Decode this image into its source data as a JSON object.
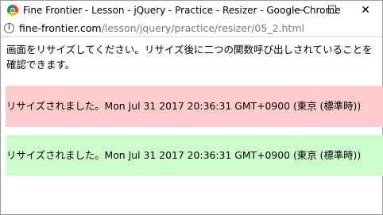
{
  "window": {
    "title": "Fine Frontier - Lesson - jQuery - Practice - Resizer - Google Chrome",
    "controls": {
      "minimize": "—",
      "maximize": "☐",
      "close": "✕"
    }
  },
  "address": {
    "domain": "fine-frontier.com",
    "path": "/lesson/jquery/practice/resizer/05_2.html"
  },
  "page": {
    "intro": "画面をリサイズしてください。リサイズ後に二つの関数呼び出しされていることを確認できます。",
    "message_red": "リサイズされました。Mon Jul 31 2017 20:36:31 GMT+0900 (東京 (標準時))",
    "message_green": "リサイズされました。Mon Jul 31 2017 20:36:31 GMT+0900 (東京 (標準時))"
  },
  "colors": {
    "red_band": "#ffcccc",
    "green_band": "#ccffcc"
  }
}
